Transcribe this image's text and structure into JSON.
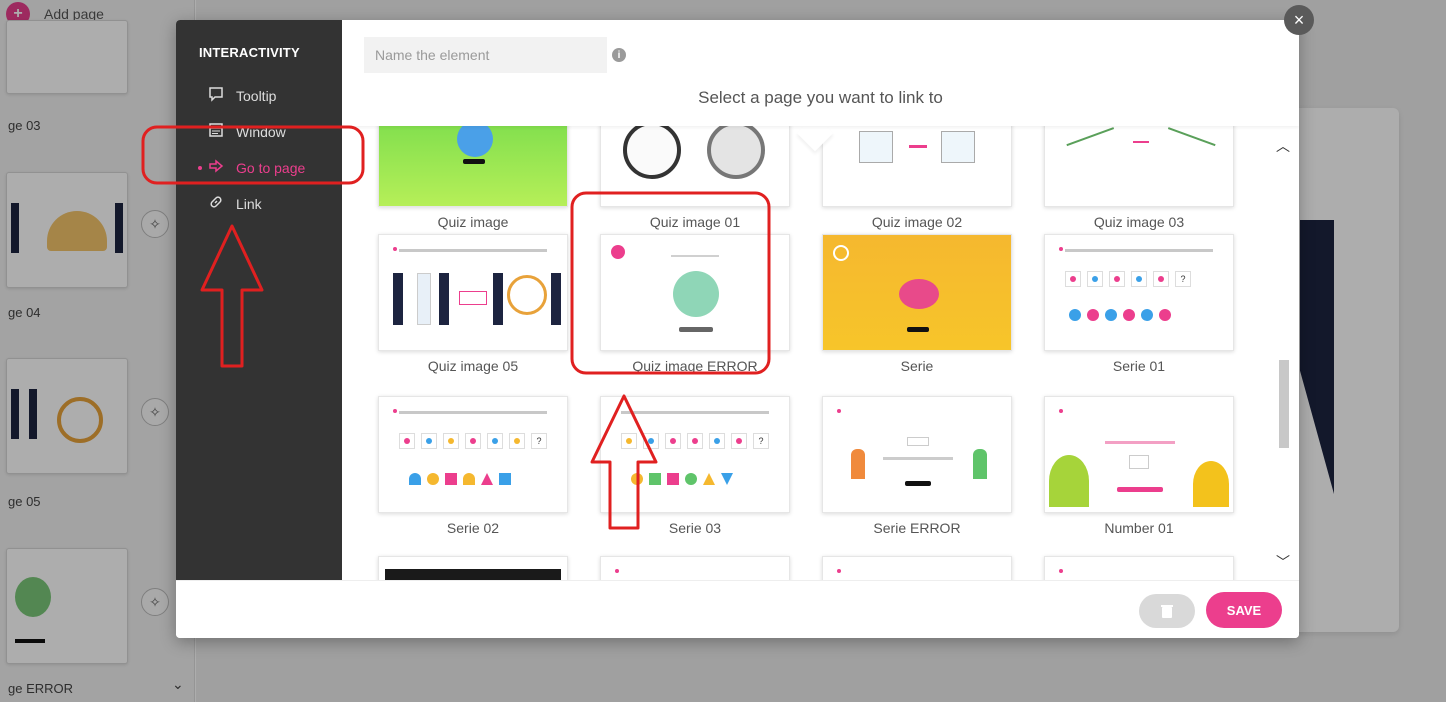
{
  "sidebar": {
    "add_page_label": "Add page",
    "pages": [
      {
        "label": "ge 03"
      },
      {
        "label": "ge 04"
      },
      {
        "label": "ge 05"
      },
      {
        "label": "ge ERROR"
      }
    ]
  },
  "modal": {
    "side_heading": "INTERACTIVITY",
    "menu": [
      {
        "label": "Tooltip",
        "icon": "tooltip-icon"
      },
      {
        "label": "Window",
        "icon": "window-icon"
      },
      {
        "label": "Go to page",
        "icon": "arrow-right-icon",
        "active": true
      },
      {
        "label": "Link",
        "icon": "link-icon"
      }
    ],
    "name_placeholder": "Name the element",
    "select_title": "Select a page you want to link to",
    "pages": [
      {
        "label": "Quiz image"
      },
      {
        "label": "Quiz image 01"
      },
      {
        "label": "Quiz image 02"
      },
      {
        "label": "Quiz image 03"
      },
      {
        "label": "Quiz image 05"
      },
      {
        "label": "Quiz image ERROR",
        "selected": true
      },
      {
        "label": "Serie"
      },
      {
        "label": "Serie 01"
      },
      {
        "label": "Serie 02"
      },
      {
        "label": "Serie 03"
      },
      {
        "label": "Serie ERROR"
      },
      {
        "label": "Number 01"
      },
      {
        "label": ""
      },
      {
        "label": ""
      },
      {
        "label": ""
      },
      {
        "label": ""
      }
    ],
    "save_label": "SAVE"
  },
  "colors": {
    "accent": "#ec3e8d",
    "sidebar_bg": "#333333",
    "annotation": "#e02020"
  }
}
